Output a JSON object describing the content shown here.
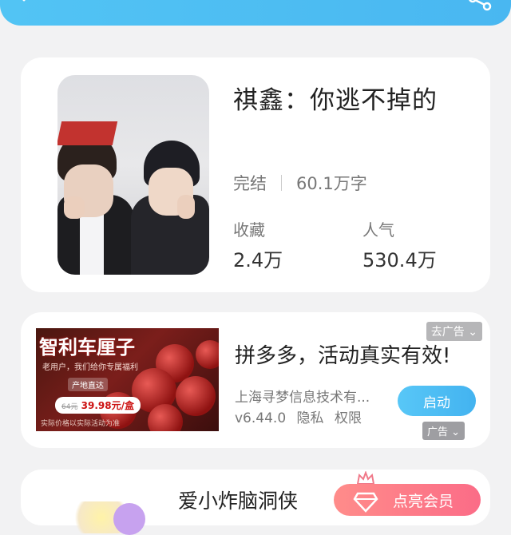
{
  "book": {
    "title": "祺鑫：你逃不掉的",
    "status": "完结",
    "word_count": "60.1万字",
    "favorites_label": "收藏",
    "favorites_value": "2.4万",
    "popularity_label": "人气",
    "popularity_value": "530.4万"
  },
  "ad": {
    "image_title": "智利车厘子",
    "image_sub": "老用户，我们给你专属福利",
    "image_tag": "产地直达",
    "image_price_old": "64元",
    "image_price": "39.98元/盒",
    "image_note": "实际价格以实际活动为准",
    "dismiss_label": "去广告 ⌄",
    "title": "拼多多，活动真实有效!",
    "company": "上海寻梦信息技术有...",
    "version": "v6.44.0",
    "privacy": "隐私",
    "permissions": "权限",
    "launch_label": "启动",
    "badge_label": "广告 ⌄"
  },
  "promo": {
    "title": "爱小炸脑洞侠",
    "vip_label": "点亮会员"
  },
  "colors": {
    "accent": "#49b7f1",
    "vip": "#fb6c87"
  }
}
